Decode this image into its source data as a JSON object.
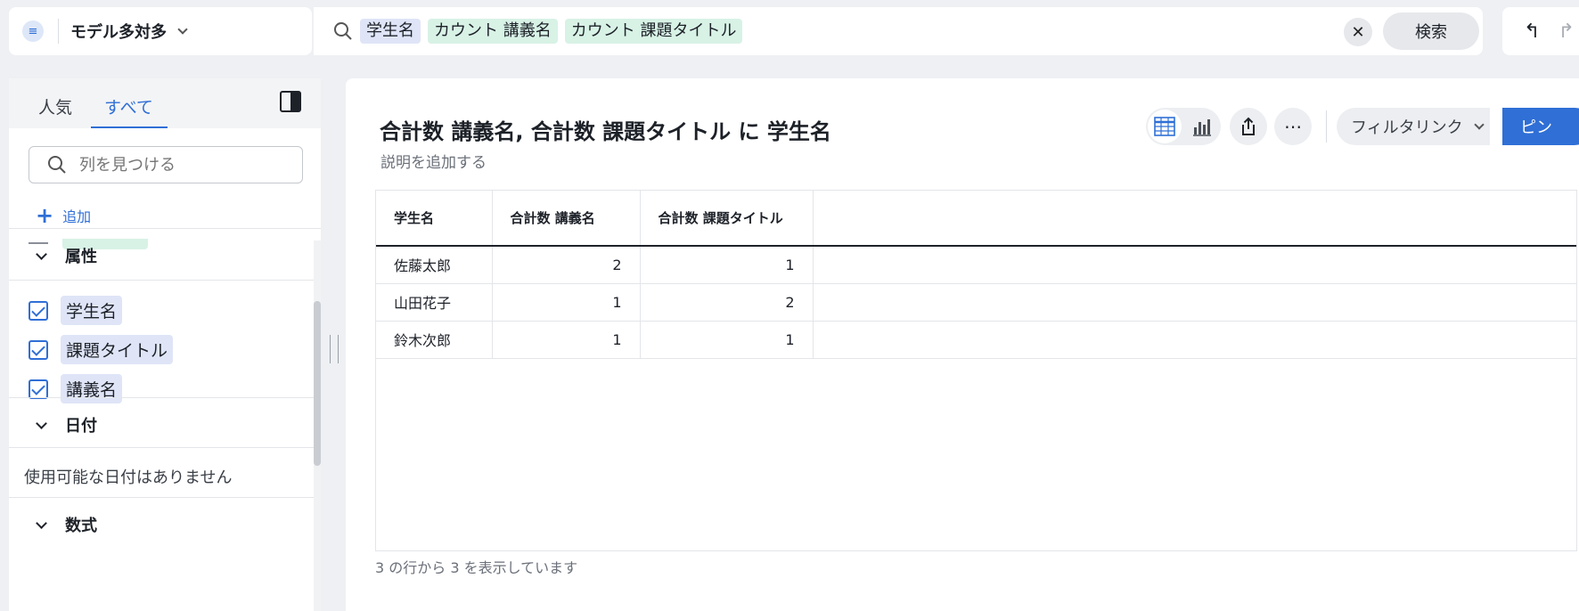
{
  "topbar": {
    "model_name": "モデル多対多",
    "search_chips": [
      {
        "label": "学生名",
        "kind": "attribute"
      },
      {
        "label": "カウント 講義名",
        "kind": "measure"
      },
      {
        "label": "カウント 課題タイトル",
        "kind": "measure"
      }
    ],
    "clear_label": "✕",
    "search_label": "検索",
    "undo_label": "↰",
    "redo_label": "↱"
  },
  "left_panel": {
    "tabs": [
      {
        "label": "人気"
      },
      {
        "label": "すべて",
        "active": true
      }
    ],
    "find_placeholder": "列を見つける",
    "add_label": "追加",
    "sections": {
      "attributes": {
        "title": "属性",
        "items": [
          "学生名",
          "課題タイトル",
          "講義名"
        ]
      },
      "dates": {
        "title": "日付",
        "empty_text": "使用可能な日付はありません"
      },
      "formulas": {
        "title": "数式"
      }
    }
  },
  "main": {
    "title": "合計数 講義名, 合計数 課題タイトル に 学生名",
    "description_placeholder": "説明を追加する",
    "more_label": "⋯",
    "filter_link_label": "フィルタリンク",
    "pin_label": "ピン",
    "table": {
      "columns": [
        "学生名",
        "合計数 講義名",
        "合計数 課題タイトル"
      ],
      "rows": [
        [
          "佐藤太郎",
          "2",
          "1"
        ],
        [
          "山田花子",
          "1",
          "2"
        ],
        [
          "鈴木次郎",
          "1",
          "1"
        ]
      ]
    },
    "footer_text": "3 の行から 3 を表示しています"
  },
  "colors": {
    "accent": "#2f6fd6",
    "attribute_chip": "#dfe5f7",
    "measure_chip": "#d8f2e6"
  },
  "icons": [
    "menu-icon",
    "chevron-down-icon",
    "search-icon",
    "close-icon",
    "undo-icon",
    "redo-icon",
    "panel-toggle-icon",
    "plus-icon",
    "checkbox-checked-icon",
    "table-view-icon",
    "bar-chart-icon",
    "share-icon",
    "more-icon"
  ]
}
